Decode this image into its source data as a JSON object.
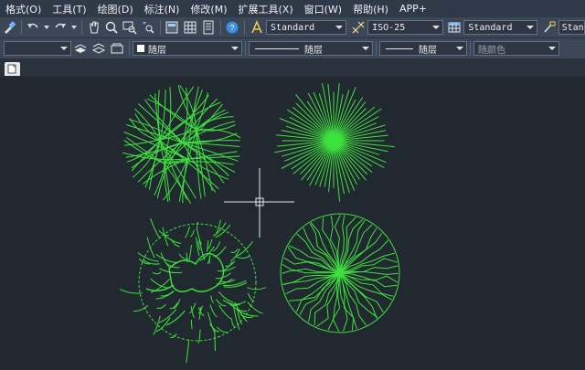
{
  "menubar": {
    "items": [
      "格式(O)",
      "工具(T)",
      "绘图(D)",
      "标注(N)",
      "修改(M)",
      "扩展工具(X)",
      "窗口(W)",
      "帮助(H)",
      "APP+"
    ]
  },
  "toolbar1": {
    "text_style": "Standard",
    "dim_style": "ISO-25",
    "table_style": "Standard",
    "multileader_style": "Stand"
  },
  "toolbar2": {
    "color": "随层",
    "linetype": "随层",
    "lineweight": "随层",
    "plot_style": "随颜色"
  },
  "colors": {
    "tree_green": "#3ee23e",
    "canvas_bg": "#212830",
    "crosshair": "#e6e6e6"
  }
}
